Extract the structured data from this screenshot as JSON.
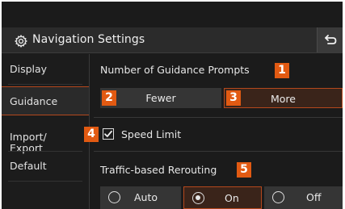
{
  "header": {
    "title": "Navigation Settings",
    "back_icon": "back-arrow-icon",
    "settings_icon": "gear-icon"
  },
  "sidebar": {
    "items": [
      {
        "label": "Display",
        "active": false
      },
      {
        "label": "Guidance",
        "active": true
      },
      {
        "label": "Import/\nExport",
        "active": false
      },
      {
        "label": "Default",
        "active": false
      }
    ]
  },
  "guidance_prompts": {
    "label": "Number of Guidance Prompts",
    "badge": "1",
    "options": [
      {
        "label": "Fewer",
        "badge": "2",
        "selected": false
      },
      {
        "label": "More",
        "badge": "3",
        "selected": true
      }
    ]
  },
  "speed_limit": {
    "label": "Speed Limit",
    "badge": "4",
    "checked": true
  },
  "traffic_rerouting": {
    "label": "Traffic-based Rerouting",
    "badge": "5",
    "options": [
      {
        "label": "Auto",
        "selected": false
      },
      {
        "label": "On",
        "selected": true
      },
      {
        "label": "Off",
        "selected": false
      }
    ]
  },
  "colors": {
    "accent": "#b5481d",
    "badge": "#e25a12",
    "background": "#1b1b1b"
  }
}
